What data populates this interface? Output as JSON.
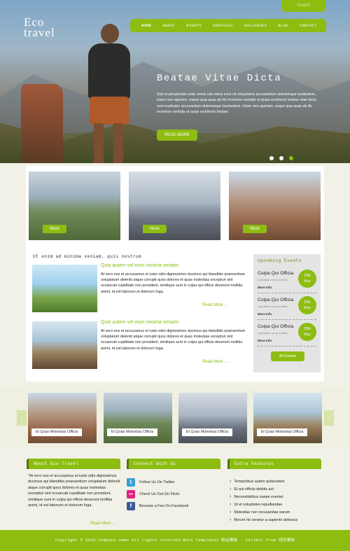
{
  "header": {
    "logo_line1": "Eco",
    "logo_line2": "travel",
    "search_placeholder": "Search",
    "nav": [
      "HOME",
      "ABOUT",
      "EVENTS",
      "SERVICES",
      "GALLERIES",
      "BLOG",
      "CONTACT"
    ],
    "hero_title": "Beatae Vitae Dicta",
    "hero_text": "Sed ut perspiciatis unde omnis iste natus error sit voluptatem accusantium doloremque laudantium, totam rem aperiam, eaque ipsa quae ab illo inventore veritatis et quasi architecto beatae vitae dicta sunt explicabo accusantium doloremque laudantium, totam rem aperiam, eaque ipsa quae ab illo inventore veritatis et quasi architecto beatae.",
    "hero_button": "READ MORE"
  },
  "thumbs": [
    {
      "label": "More"
    },
    {
      "label": "More"
    },
    {
      "label": "More"
    }
  ],
  "articles": {
    "section_title": "Ut enim ad minima veniam, quis nostrum",
    "items": [
      {
        "title": "Quis autem vel eum minima veniam",
        "text": "At vero eos et accusamus et iusto odio dignissimos ducimus qui blanditiis praesentium voluptatum deleniti atque corrupti quos dolores et quas molestias excepturi sint occaecati cupiditate non provident, similique sunt in culpa qui officia deserunt mollitia animi, id est laborum et dolorum fuga.",
        "read_more": "Read More →"
      },
      {
        "title": "Quis autem vel eum minima veniam",
        "text": "At vero eos et accusamus et iusto odio dignissimos ducimus qui blanditiis praesentium voluptatum deleniti atque corrupti quos dolores et quas molestias excepturi sint occaecati cupiditate non provident, similique sunt in culpa qui officia deserunt mollitia animi, id est laborum et dolorum fuga.",
        "read_more": "Read More →"
      }
    ]
  },
  "events": {
    "title": "Upcoming Events",
    "items": [
      {
        "title": "Culpa Qui Officia",
        "sub": "cupiditate non provident",
        "more": "More Info",
        "day": "15th",
        "month": "May"
      },
      {
        "title": "Culpa Qui Officia",
        "sub": "cupiditate non provident",
        "more": "More Info",
        "day": "15th",
        "month": "May"
      },
      {
        "title": "Culpa Qui Officia",
        "sub": "cupiditate non provident",
        "more": "More Info",
        "day": "15th",
        "month": "May"
      }
    ],
    "all_button": "All Events"
  },
  "gallery": {
    "captions": [
      "Et Quas Molestias Officia",
      "Et Quas Molestias Officia",
      "Et Quas Molestias Officia",
      "Et Quas Molestias Officia"
    ],
    "prev": "‹",
    "next": "›"
  },
  "footer": {
    "about_title": "About Eco Travel",
    "about_text": "\"At vero eos et accusamus et iusto odio dignissimos ducimus qui blanditiis praesentium voluptatum deleniti atque corrupti quos dolores et quas molestias excepturi sint occaecati cupiditate non provident, similique sunt in culpa qui officia deserunt mollitia animi, id est laborum et dolorum fuga.",
    "about_read_more": "Read More →",
    "connect_title": "Connect With Us",
    "social": [
      {
        "icon": "twitter-icon",
        "glyph": "t",
        "color": "#3a9fd6",
        "label": "Follow Us On Twitter"
      },
      {
        "icon": "flickr-icon",
        "glyph": "●●",
        "color": "#e0207f",
        "label": "Check Us Out On Flickr"
      },
      {
        "icon": "facebook-icon",
        "glyph": "f",
        "color": "#3b5998",
        "label": "Become a Fan On Facebook"
      }
    ],
    "extra_title": "Extra Features",
    "extra_links": [
      "Temporibus autem quibusdam",
      "Et aut officiis debitis aut",
      "Necessitatibus saepe eveniet",
      "Ut et voluptates repudiandae",
      "Molestiae non recusandae earum",
      "Rerum hic tenetur a sapiente delectus"
    ],
    "copyright": "Copyright © 2015.Company name All rights reserved.More Templates 网站模板 - Collect from 网页模板"
  },
  "colors": {
    "accent": "#8cbd10",
    "accent_dark": "#557409",
    "panel_bg": "#ffffff",
    "page_bg": "#f1f1e7"
  }
}
